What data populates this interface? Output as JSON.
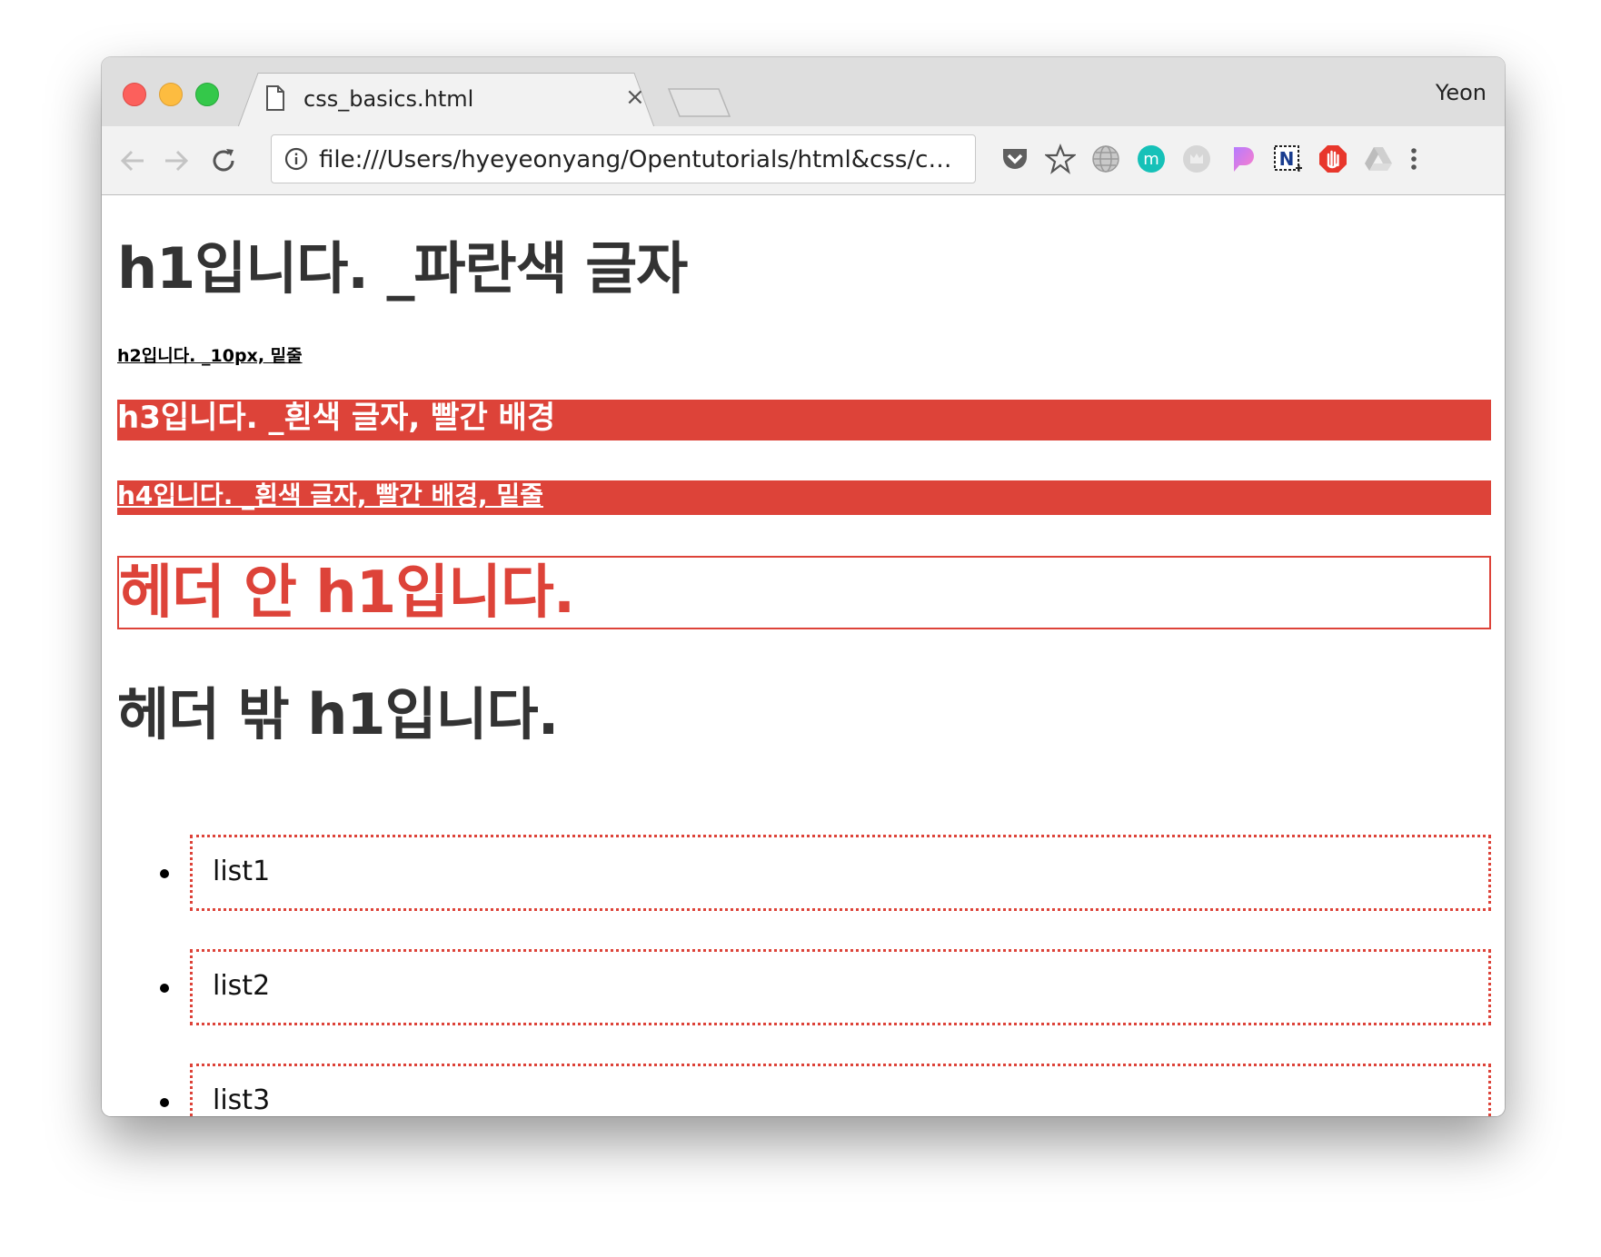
{
  "browser": {
    "tab_title": "css_basics.html",
    "tab_close_glyph": "×",
    "profile_name": "Yeon",
    "url": "file:///Users/hyeyeonyang/Opentutorials/html&css/cs...",
    "extensions": [
      "pocket-icon",
      "bookmark-star-icon",
      "globe-icon",
      "m-extension-icon",
      "gray-extension-icon",
      "pink-extension-icon",
      "n-extension-icon",
      "adblock-icon",
      "drive-icon",
      "menu-icon"
    ],
    "extension_m_letter": "m",
    "extension_n_letter": "N"
  },
  "page": {
    "h1_blue": "h1입니다. _파란색 글자",
    "h2_underline": "h2입니다. _10px, 밑줄",
    "h3_red_bg": "h3입니다. _흰색 글자, 빨간 배경",
    "h4_red_bg_underline": "h4입니다. _흰색 글자, 빨간 배경, 밑줄",
    "header_h1": "헤더 안 h1입니다.",
    "outside_h1": "헤더 밖 h1입니다.",
    "list_items": [
      "list1",
      "list2",
      "list3"
    ]
  },
  "colors": {
    "accent_red": "#dd4339",
    "text_dark": "#333333"
  }
}
